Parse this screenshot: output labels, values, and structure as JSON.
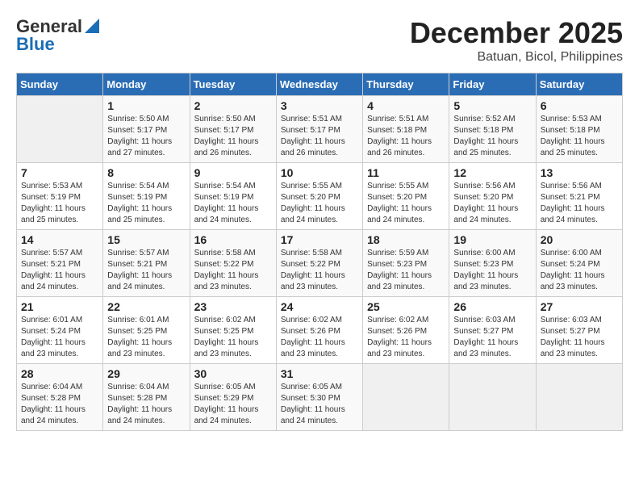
{
  "logo": {
    "line1": "General",
    "line2": "Blue"
  },
  "title": "December 2025",
  "subtitle": "Batuan, Bicol, Philippines",
  "headers": [
    "Sunday",
    "Monday",
    "Tuesday",
    "Wednesday",
    "Thursday",
    "Friday",
    "Saturday"
  ],
  "weeks": [
    [
      {
        "day": "",
        "sunrise": "",
        "sunset": "",
        "daylight": ""
      },
      {
        "day": "1",
        "sunrise": "Sunrise: 5:50 AM",
        "sunset": "Sunset: 5:17 PM",
        "daylight": "Daylight: 11 hours and 27 minutes."
      },
      {
        "day": "2",
        "sunrise": "Sunrise: 5:50 AM",
        "sunset": "Sunset: 5:17 PM",
        "daylight": "Daylight: 11 hours and 26 minutes."
      },
      {
        "day": "3",
        "sunrise": "Sunrise: 5:51 AM",
        "sunset": "Sunset: 5:17 PM",
        "daylight": "Daylight: 11 hours and 26 minutes."
      },
      {
        "day": "4",
        "sunrise": "Sunrise: 5:51 AM",
        "sunset": "Sunset: 5:18 PM",
        "daylight": "Daylight: 11 hours and 26 minutes."
      },
      {
        "day": "5",
        "sunrise": "Sunrise: 5:52 AM",
        "sunset": "Sunset: 5:18 PM",
        "daylight": "Daylight: 11 hours and 25 minutes."
      },
      {
        "day": "6",
        "sunrise": "Sunrise: 5:53 AM",
        "sunset": "Sunset: 5:18 PM",
        "daylight": "Daylight: 11 hours and 25 minutes."
      }
    ],
    [
      {
        "day": "7",
        "sunrise": "Sunrise: 5:53 AM",
        "sunset": "Sunset: 5:19 PM",
        "daylight": "Daylight: 11 hours and 25 minutes."
      },
      {
        "day": "8",
        "sunrise": "Sunrise: 5:54 AM",
        "sunset": "Sunset: 5:19 PM",
        "daylight": "Daylight: 11 hours and 25 minutes."
      },
      {
        "day": "9",
        "sunrise": "Sunrise: 5:54 AM",
        "sunset": "Sunset: 5:19 PM",
        "daylight": "Daylight: 11 hours and 24 minutes."
      },
      {
        "day": "10",
        "sunrise": "Sunrise: 5:55 AM",
        "sunset": "Sunset: 5:20 PM",
        "daylight": "Daylight: 11 hours and 24 minutes."
      },
      {
        "day": "11",
        "sunrise": "Sunrise: 5:55 AM",
        "sunset": "Sunset: 5:20 PM",
        "daylight": "Daylight: 11 hours and 24 minutes."
      },
      {
        "day": "12",
        "sunrise": "Sunrise: 5:56 AM",
        "sunset": "Sunset: 5:20 PM",
        "daylight": "Daylight: 11 hours and 24 minutes."
      },
      {
        "day": "13",
        "sunrise": "Sunrise: 5:56 AM",
        "sunset": "Sunset: 5:21 PM",
        "daylight": "Daylight: 11 hours and 24 minutes."
      }
    ],
    [
      {
        "day": "14",
        "sunrise": "Sunrise: 5:57 AM",
        "sunset": "Sunset: 5:21 PM",
        "daylight": "Daylight: 11 hours and 24 minutes."
      },
      {
        "day": "15",
        "sunrise": "Sunrise: 5:57 AM",
        "sunset": "Sunset: 5:21 PM",
        "daylight": "Daylight: 11 hours and 24 minutes."
      },
      {
        "day": "16",
        "sunrise": "Sunrise: 5:58 AM",
        "sunset": "Sunset: 5:22 PM",
        "daylight": "Daylight: 11 hours and 23 minutes."
      },
      {
        "day": "17",
        "sunrise": "Sunrise: 5:58 AM",
        "sunset": "Sunset: 5:22 PM",
        "daylight": "Daylight: 11 hours and 23 minutes."
      },
      {
        "day": "18",
        "sunrise": "Sunrise: 5:59 AM",
        "sunset": "Sunset: 5:23 PM",
        "daylight": "Daylight: 11 hours and 23 minutes."
      },
      {
        "day": "19",
        "sunrise": "Sunrise: 6:00 AM",
        "sunset": "Sunset: 5:23 PM",
        "daylight": "Daylight: 11 hours and 23 minutes."
      },
      {
        "day": "20",
        "sunrise": "Sunrise: 6:00 AM",
        "sunset": "Sunset: 5:24 PM",
        "daylight": "Daylight: 11 hours and 23 minutes."
      }
    ],
    [
      {
        "day": "21",
        "sunrise": "Sunrise: 6:01 AM",
        "sunset": "Sunset: 5:24 PM",
        "daylight": "Daylight: 11 hours and 23 minutes."
      },
      {
        "day": "22",
        "sunrise": "Sunrise: 6:01 AM",
        "sunset": "Sunset: 5:25 PM",
        "daylight": "Daylight: 11 hours and 23 minutes."
      },
      {
        "day": "23",
        "sunrise": "Sunrise: 6:02 AM",
        "sunset": "Sunset: 5:25 PM",
        "daylight": "Daylight: 11 hours and 23 minutes."
      },
      {
        "day": "24",
        "sunrise": "Sunrise: 6:02 AM",
        "sunset": "Sunset: 5:26 PM",
        "daylight": "Daylight: 11 hours and 23 minutes."
      },
      {
        "day": "25",
        "sunrise": "Sunrise: 6:02 AM",
        "sunset": "Sunset: 5:26 PM",
        "daylight": "Daylight: 11 hours and 23 minutes."
      },
      {
        "day": "26",
        "sunrise": "Sunrise: 6:03 AM",
        "sunset": "Sunset: 5:27 PM",
        "daylight": "Daylight: 11 hours and 23 minutes."
      },
      {
        "day": "27",
        "sunrise": "Sunrise: 6:03 AM",
        "sunset": "Sunset: 5:27 PM",
        "daylight": "Daylight: 11 hours and 23 minutes."
      }
    ],
    [
      {
        "day": "28",
        "sunrise": "Sunrise: 6:04 AM",
        "sunset": "Sunset: 5:28 PM",
        "daylight": "Daylight: 11 hours and 24 minutes."
      },
      {
        "day": "29",
        "sunrise": "Sunrise: 6:04 AM",
        "sunset": "Sunset: 5:28 PM",
        "daylight": "Daylight: 11 hours and 24 minutes."
      },
      {
        "day": "30",
        "sunrise": "Sunrise: 6:05 AM",
        "sunset": "Sunset: 5:29 PM",
        "daylight": "Daylight: 11 hours and 24 minutes."
      },
      {
        "day": "31",
        "sunrise": "Sunrise: 6:05 AM",
        "sunset": "Sunset: 5:30 PM",
        "daylight": "Daylight: 11 hours and 24 minutes."
      },
      {
        "day": "",
        "sunrise": "",
        "sunset": "",
        "daylight": ""
      },
      {
        "day": "",
        "sunrise": "",
        "sunset": "",
        "daylight": ""
      },
      {
        "day": "",
        "sunrise": "",
        "sunset": "",
        "daylight": ""
      }
    ]
  ]
}
